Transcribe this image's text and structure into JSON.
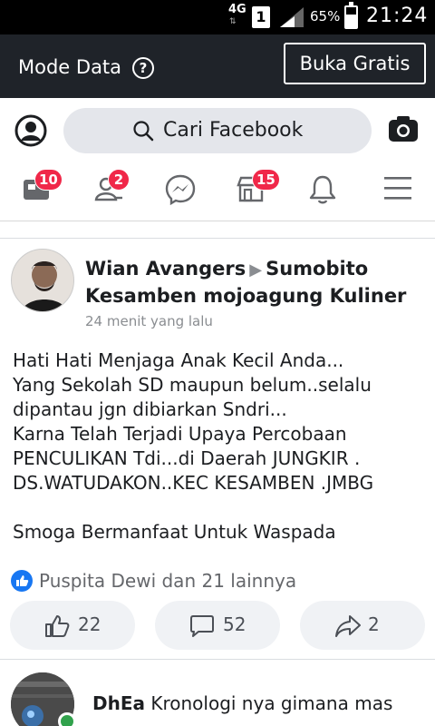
{
  "status_bar": {
    "network": "4G",
    "sim": "1",
    "battery_percent": "65%",
    "battery_level": 0.65,
    "time": "21:24"
  },
  "data_banner": {
    "mode_label": "Mode Data",
    "help_icon": "question-circle-icon",
    "free_button": "Buka Gratis"
  },
  "header": {
    "search_placeholder": "Cari Facebook",
    "icons": [
      "profile-icon",
      "search-icon",
      "camera-icon"
    ]
  },
  "nav": {
    "feed_badge": "10",
    "friends_badge": "2",
    "marketplace_badge": "15",
    "items": [
      "news-feed-icon",
      "friends-icon",
      "messenger-icon",
      "marketplace-icon",
      "bell-icon",
      "menu-icon"
    ]
  },
  "post": {
    "author": "Wian Avangers",
    "separator": "▶",
    "group": "Sumobito Kesamben mojoagung Kuliner",
    "timestamp": "24 menit yang lalu",
    "body": "Hati Hati Menjaga Anak Kecil Anda...\nYang Sekolah SD maupun belum..selalu dipantau jgn dibiarkan Sndri...\nKarna Telah Terjadi Upaya Percobaan PENCULIKAN Tdi...di Daerah JUNGKIR . DS.WATUDAKON..KEC KESAMBEN .JMBG\n\nSmoga Bermanfaat Untuk Waspada",
    "likes_text": "Puspita Dewi dan 21 lainnya",
    "like_count": "22",
    "comment_count": "52",
    "share_count": "2"
  },
  "comment": {
    "author": "DhEa",
    "text": "Kronologi nya gimana mas"
  },
  "colors": {
    "banner_bg": "#1f2329",
    "badge": "#f02849",
    "like_blue": "#1877f2",
    "online_green": "#31a24c"
  }
}
